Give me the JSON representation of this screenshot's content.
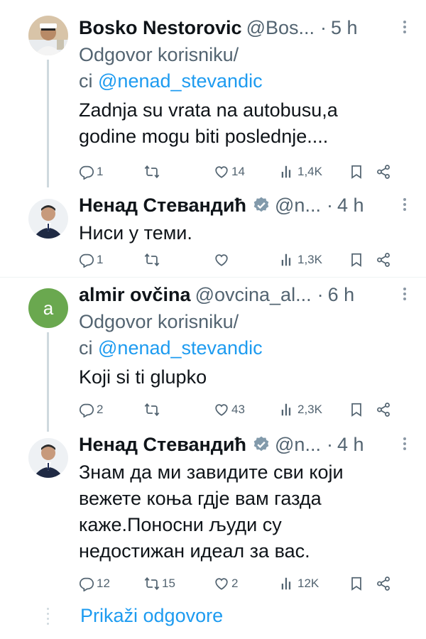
{
  "tweets": [
    {
      "name": "Bosko Nestorovic",
      "handle": "@Bos...",
      "dot": "·",
      "time": "5 h",
      "replying_prefix": "Odgovor korisniku/",
      "replying_ci": "ci",
      "replying_mention": "@nenad_stevandic",
      "lines": [
        "Zadnja su vrata na autobusu,a",
        "godine mogu biti poslednje...."
      ],
      "replies": "1",
      "retweets": "",
      "likes": "14",
      "views": "1,4K"
    },
    {
      "name": "Ненад Стевандић",
      "handle": "@n...",
      "dot": "·",
      "time": "4 h",
      "lines": [
        "Ниси у теми."
      ],
      "replies": "1",
      "retweets": "",
      "likes": "",
      "views": "1,3K"
    },
    {
      "name": "almir ovčina",
      "handle": "@ovcina_al...",
      "dot": "·",
      "time": "6 h",
      "avatar_letter": "a",
      "replying_prefix": "Odgovor korisniku/",
      "replying_ci": "ci",
      "replying_mention": "@nenad_stevandic",
      "lines": [
        "Koji si ti glupko"
      ],
      "replies": "2",
      "retweets": "",
      "likes": "43",
      "views": "2,3K"
    },
    {
      "name": "Ненад Стевандић",
      "handle": "@n...",
      "dot": "·",
      "time": "4 h",
      "lines": [
        "Знам да ми завидите сви који",
        "вежете коња гдје вам газда",
        "каже.Поносни људи су",
        "недостижан идеал за вас."
      ],
      "replies": "12",
      "retweets": "15",
      "likes": "2",
      "views": "12K"
    }
  ],
  "show_replies": "Prikaži odgovore",
  "colors": {
    "link": "#1d9bf0",
    "muted": "#536471",
    "verified": "#829aab",
    "avatar_green": "#6aa84f"
  },
  "icons": [
    "reply-icon",
    "retweet-icon",
    "like-icon",
    "views-icon",
    "bookmark-icon",
    "share-icon",
    "verified-icon",
    "more-icon"
  ]
}
